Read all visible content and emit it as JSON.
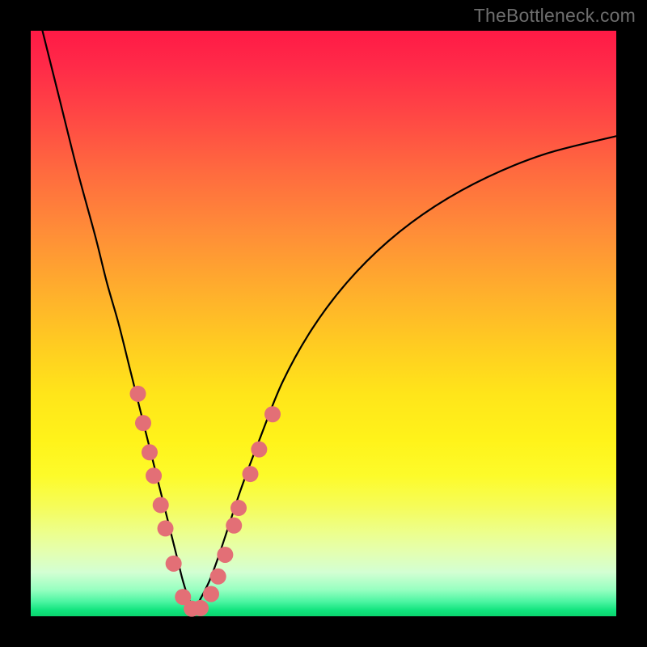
{
  "watermark": "TheBottleneck.com",
  "chart_data": {
    "type": "line",
    "title": "",
    "xlabel": "",
    "ylabel": "",
    "xlim": [
      0,
      100
    ],
    "ylim": [
      0,
      100
    ],
    "grid": false,
    "legend": false,
    "series": [
      {
        "name": "bottleneck-curve",
        "x": [
          2,
          5,
          8,
          11,
          13,
          15,
          17,
          19,
          20.5,
          22,
          23.5,
          25,
          26,
          27,
          28,
          29,
          30.5,
          32,
          34,
          36,
          39,
          43,
          48,
          54,
          61,
          69,
          78,
          88,
          100
        ],
        "y": [
          100,
          88,
          76,
          65,
          57,
          50,
          42,
          34,
          28,
          22,
          16,
          10,
          6,
          3,
          1.2,
          3,
          6,
          10,
          16,
          22,
          30,
          40,
          49,
          57,
          64,
          70,
          75,
          79,
          82
        ]
      }
    ],
    "markers": {
      "name": "highlight-dots",
      "color": "#e36f76",
      "radius_px": 10,
      "points": [
        [
          18.3,
          38
        ],
        [
          19.2,
          33
        ],
        [
          20.3,
          28
        ],
        [
          21.0,
          24
        ],
        [
          22.2,
          19
        ],
        [
          23.0,
          15
        ],
        [
          24.4,
          9
        ],
        [
          26.0,
          3.3
        ],
        [
          27.5,
          1.3
        ],
        [
          29.0,
          1.4
        ],
        [
          30.8,
          3.8
        ],
        [
          32.0,
          6.8
        ],
        [
          33.2,
          10.5
        ],
        [
          34.7,
          15.5
        ],
        [
          35.5,
          18.5
        ],
        [
          37.5,
          24.3
        ],
        [
          39.0,
          28.5
        ],
        [
          41.3,
          34.5
        ]
      ]
    }
  }
}
